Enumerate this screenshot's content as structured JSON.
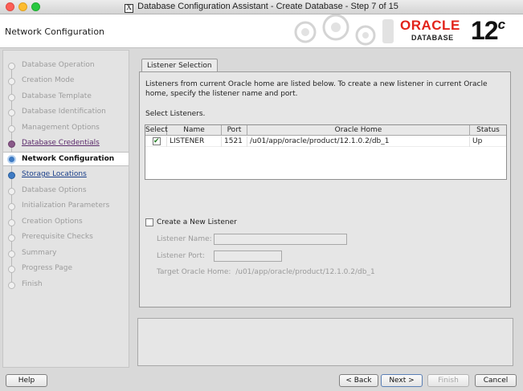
{
  "window": {
    "title": "Database Configuration Assistant - Create Database - Step 7 of 15"
  },
  "header": {
    "title": "Network Configuration",
    "brand": "ORACLE",
    "brand_sub": "DATABASE",
    "version": "12",
    "version_suffix": "c"
  },
  "nav": {
    "items": [
      {
        "label": "Database Operation",
        "state": "disabled"
      },
      {
        "label": "Creation Mode",
        "state": "disabled"
      },
      {
        "label": "Database Template",
        "state": "disabled"
      },
      {
        "label": "Database Identification",
        "state": "disabled"
      },
      {
        "label": "Management Options",
        "state": "disabled"
      },
      {
        "label": "Database Credentials",
        "state": "visited"
      },
      {
        "label": "Network Configuration",
        "state": "current"
      },
      {
        "label": "Storage Locations",
        "state": "link"
      },
      {
        "label": "Database Options",
        "state": "disabled"
      },
      {
        "label": "Initialization Parameters",
        "state": "disabled"
      },
      {
        "label": "Creation Options",
        "state": "disabled"
      },
      {
        "label": "Prerequisite Checks",
        "state": "disabled"
      },
      {
        "label": "Summary",
        "state": "disabled"
      },
      {
        "label": "Progress Page",
        "state": "disabled"
      },
      {
        "label": "Finish",
        "state": "disabled"
      }
    ]
  },
  "listener": {
    "tab_label": "Listener Selection",
    "description": "Listeners from current Oracle home are listed below. To create a new listener in current Oracle home, specify the listener name and port.",
    "select_label": "Select Listeners.",
    "columns": [
      "Select",
      "Name",
      "Port",
      "Oracle Home",
      "Status"
    ],
    "rows": [
      {
        "selected": true,
        "name": "LISTENER",
        "port": "1521",
        "home": "/u01/app/oracle/product/12.1.0.2/db_1",
        "status": "Up"
      }
    ]
  },
  "new_listener": {
    "checkbox_label": "Create a New Listener",
    "name_label": "Listener Name:",
    "name_value": "",
    "port_label": "Listener Port:",
    "port_value": "",
    "home_label": "Target Oracle Home:",
    "home_value": "/u01/app/oracle/product/12.1.0.2/db_1"
  },
  "buttons": {
    "help": "Help",
    "back": "< Back",
    "next": "Next >",
    "finish": "Finish",
    "cancel": "Cancel"
  },
  "colors": {
    "oracle_red": "#e2231a",
    "nav_current_dot": "#3e7bc4",
    "nav_visited": "#5b2a6b"
  }
}
